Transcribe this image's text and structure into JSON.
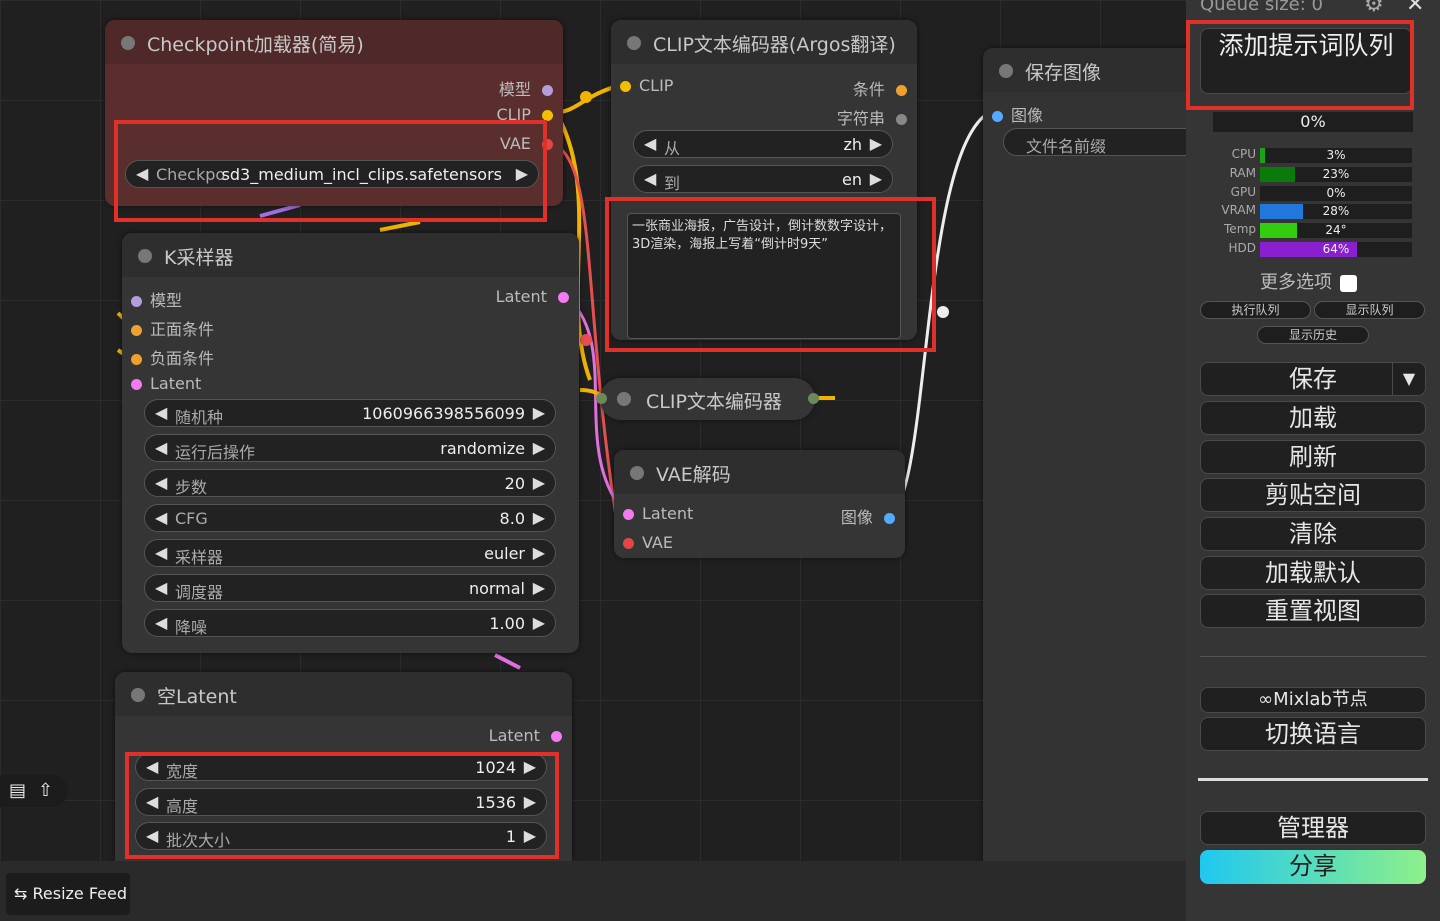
{
  "nodes": {
    "checkpoint": {
      "title": "Checkpoint加载器(简易)",
      "outputs": [
        "模型",
        "CLIP",
        "VAE"
      ],
      "widget_name": "Checkpo",
      "widget_value": "sd3_medium_incl_clips.safetensors"
    },
    "clip_argos": {
      "title": "CLIP文本编码器(Argos翻译)",
      "input": "CLIP",
      "outputs": [
        "条件",
        "字符串"
      ],
      "from_label": "从",
      "from_value": "zh",
      "to_label": "到",
      "to_value": "en",
      "prompt": "一张商业海报，广告设计，倒计数数字设计，3D渲染，海报上写着“倒计时9天”"
    },
    "clip_encoder": {
      "title": "CLIP文本编码器"
    },
    "vae_decode": {
      "title": "VAE解码",
      "inputs": [
        "Latent",
        "VAE"
      ],
      "output": "图像"
    },
    "save_image": {
      "title": "保存图像",
      "input": "图像",
      "prefix_label": "文件名前缀"
    },
    "ksampler": {
      "title": "K采样器",
      "inputs": [
        "模型",
        "正面条件",
        "负面条件",
        "Latent"
      ],
      "output": "Latent",
      "widgets": [
        {
          "name": "随机种",
          "value": "1060966398556099"
        },
        {
          "name": "运行后操作",
          "value": "randomize"
        },
        {
          "name": "步数",
          "value": "20"
        },
        {
          "name": "CFG",
          "value": "8.0"
        },
        {
          "name": "采样器",
          "value": "euler"
        },
        {
          "name": "调度器",
          "value": "normal"
        },
        {
          "name": "降噪",
          "value": "1.00"
        }
      ]
    },
    "empty_latent": {
      "title": "空Latent",
      "output": "Latent",
      "widgets": [
        {
          "name": "宽度",
          "value": "1024"
        },
        {
          "name": "高度",
          "value": "1536"
        },
        {
          "name": "批次大小",
          "value": "1"
        }
      ]
    }
  },
  "sidebar": {
    "queue_size": "Queue size: 0",
    "queue_button": "添加提示词队列",
    "progress": "0%",
    "stats": [
      {
        "label": "CPU",
        "value": "3%",
        "fraction": 0.03,
        "color": "#1aa31a"
      },
      {
        "label": "RAM",
        "value": "23%",
        "fraction": 0.23,
        "color": "#0a7a0a"
      },
      {
        "label": "GPU",
        "value": "0%",
        "fraction": 0.0,
        "color": "#1aa31a"
      },
      {
        "label": "VRAM",
        "value": "28%",
        "fraction": 0.28,
        "color": "#2277dd"
      },
      {
        "label": "Temp",
        "value": "24°",
        "fraction": 0.24,
        "color": "#33cc11"
      },
      {
        "label": "HDD",
        "value": "64%",
        "fraction": 0.64,
        "color": "#8a1fcf"
      }
    ],
    "more_options": "更多选项",
    "view_queue": "执行队列",
    "show_queue": "显示队列",
    "show_history": "显示历史",
    "buttons": [
      "保存",
      "加载",
      "刷新",
      "剪贴空间",
      "清除",
      "加载默认",
      "重置视图"
    ],
    "mixlab": "Mixlab节点",
    "switch_lang": "切换语言",
    "manager": "管理器",
    "share": "分享"
  },
  "resize_feed": "Resize Feed"
}
